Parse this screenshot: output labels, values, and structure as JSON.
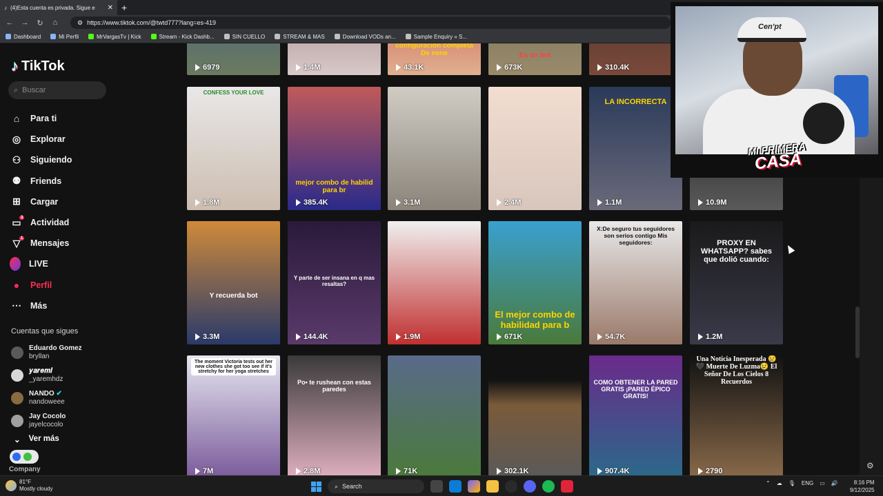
{
  "browser": {
    "tab_title": "(4)Esta cuenta es privada. Sigue e",
    "url": "https://www.tiktok.com/@twtd777?lang=es-419",
    "bookmarks": [
      "Dashboard",
      "Mi Perfil",
      "MrVargasTv | Kick",
      "Stream - Kick Dashb...",
      "SIN CUELLO",
      "STREAM & MAS",
      "Download VODs an...",
      "Sample Enquiry « S..."
    ]
  },
  "sidebar": {
    "logo": "TikTok",
    "search_placeholder": "Buscar",
    "nav": [
      {
        "label": "Para ti",
        "icon": "home-icon"
      },
      {
        "label": "Explorar",
        "icon": "compass-icon"
      },
      {
        "label": "Siguiendo",
        "icon": "following-icon"
      },
      {
        "label": "Friends",
        "icon": "friends-icon"
      },
      {
        "label": "Cargar",
        "icon": "upload-icon"
      },
      {
        "label": "Actividad",
        "icon": "activity-icon",
        "badge": "3"
      },
      {
        "label": "Mensajes",
        "icon": "messages-icon",
        "badge": "1"
      },
      {
        "label": "LIVE",
        "icon": "live-icon"
      },
      {
        "label": "Perfil",
        "icon": "profile-icon",
        "active": true
      },
      {
        "label": "Más",
        "icon": "more-icon"
      }
    ],
    "following_title": "Cuentas que sigues",
    "following": [
      {
        "name": "Eduardo Gomez",
        "handle": "bryllan"
      },
      {
        "name": "𝒚𝒂𝒓𝒆𝒎𝒊",
        "handle": "_yaremhdz"
      },
      {
        "name": "NANDO",
        "handle": "nandoweee"
      },
      {
        "name": "Jay Cocolo",
        "handle": "jayelcocolo"
      }
    ],
    "see_more": "Ver más",
    "company": "Company"
  },
  "videos": {
    "row0": [
      "6979",
      "1.4M",
      "43.1K",
      "673K",
      "310.4K"
    ],
    "row0_captions": [
      "",
      "",
      "configuración completa De nene",
      "Es un bot",
      ""
    ],
    "row1": [
      "1.8M",
      "385.4K",
      "3.1M",
      "2.4M",
      "1.1M",
      "10.9M"
    ],
    "row1_captions": [
      "CONFESS YOUR LOVE",
      "mejor combo de habilid para br",
      "",
      "",
      "LA INCORRECTA",
      ""
    ],
    "row2": [
      "3.3M",
      "144.4K",
      "1.9M",
      "671K",
      "54.7K",
      "1.2M"
    ],
    "row2_captions": [
      "Y recuerda bot",
      "Y parte de ser insana en q mas resaltas?",
      "",
      "El mejor combo de habilidad para b",
      "X:De seguro tus seguidores son serios contigo Mis seguidores:",
      "PROXY EN WHATSAPP? sabes que dolió cuando:"
    ],
    "row3": [
      "7M",
      "2.8M",
      "71K",
      "302.1K",
      "907.4K",
      "2790"
    ],
    "row3_captions": [
      "The moment Victoria tests out her new clothes she got too see if it's stretchy for her yoga stretches",
      "Po• te rushean con estas paredes",
      "",
      "",
      "COMO OBTENER LA PARED GRATIS ¡PARED ÉPICO GRATIS!",
      "Una Noticia Inesperada 😢🖤 Muerte De Luzma😢 El Señor De Los Cielos 8 Recuerdos"
    ]
  },
  "webcam": {
    "cap_text": "Cen'pt",
    "logo_line1": "MI PRIMERA",
    "logo_line2": "CASA"
  },
  "taskbar": {
    "temp": "81°F",
    "weather": "Mostly cloudy",
    "search": "Search",
    "lang": "ENG",
    "time": "8:16 PM",
    "date": "9/12/2025"
  }
}
